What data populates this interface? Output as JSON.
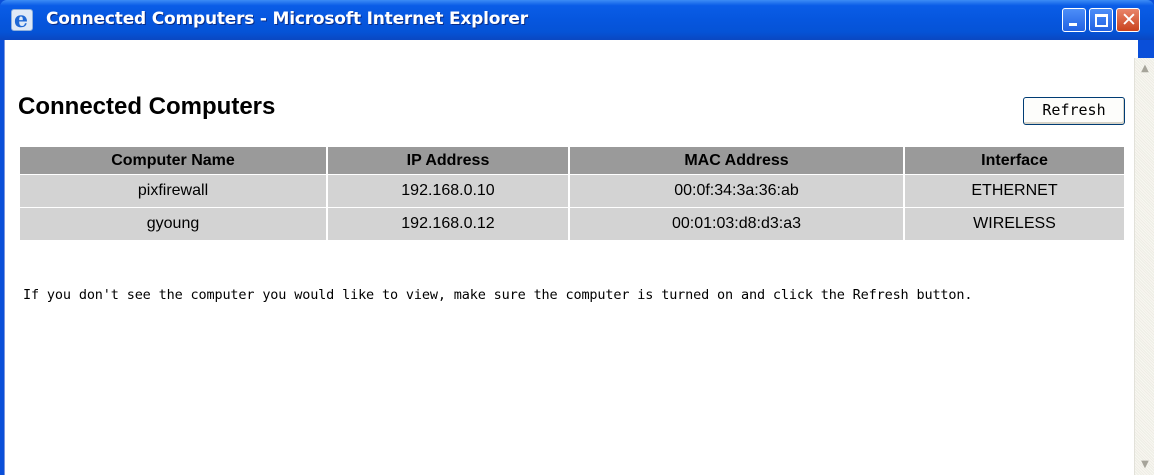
{
  "window": {
    "title": "Connected Computers - Microsoft Internet Explorer",
    "icons": {
      "app": "internet-explorer-icon",
      "minimize": "minimize-icon",
      "maximize": "maximize-icon",
      "close": "close-icon"
    }
  },
  "page": {
    "heading": "Connected Computers",
    "refresh_label": "Refresh",
    "table": {
      "headers": [
        "Computer Name",
        "IP Address",
        "MAC Address",
        "Interface"
      ],
      "rows": [
        [
          "pixfirewall",
          "192.168.0.10",
          "00:0f:34:3a:36:ab",
          "ETHERNET"
        ],
        [
          "gyoung",
          "192.168.0.12",
          "00:01:03:d8:d3:a3",
          "WIRELESS"
        ]
      ]
    },
    "note": "If you don't see the computer you would like to view, make sure the computer is turned on and click the Refresh button."
  },
  "scrollbar": {
    "up_icon": "scroll-up-arrow-icon",
    "down_icon": "scroll-down-arrow-icon"
  },
  "colors": {
    "titlebar": "#0553d6",
    "close_button": "#c9421e",
    "table_header": "#9a9a9a",
    "table_cell": "#d3d3d3"
  }
}
